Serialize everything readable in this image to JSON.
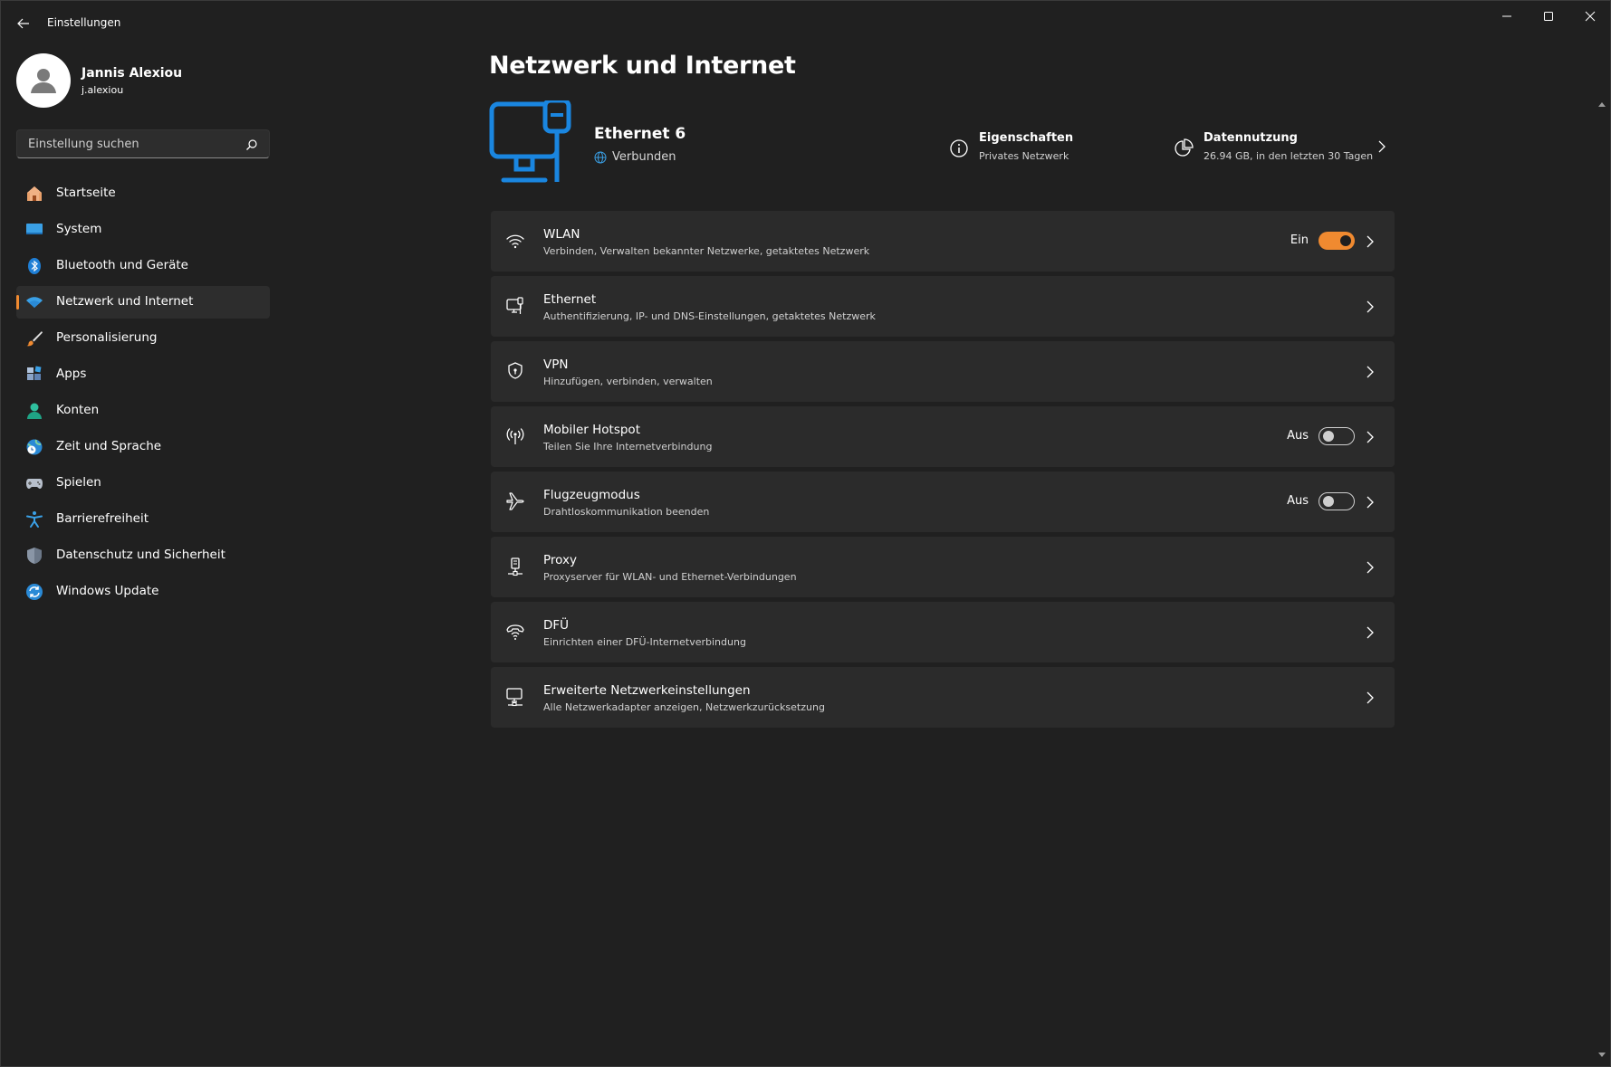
{
  "window": {
    "title": "Einstellungen"
  },
  "profile": {
    "name": "Jannis Alexiou",
    "username": "j.alexiou"
  },
  "search": {
    "placeholder": "Einstellung suchen"
  },
  "sidebar": {
    "items": [
      {
        "label": "Startseite",
        "icon": "home-icon"
      },
      {
        "label": "System",
        "icon": "system-icon"
      },
      {
        "label": "Bluetooth und Geräte",
        "icon": "bluetooth-icon"
      },
      {
        "label": "Netzwerk und Internet",
        "icon": "wifi-icon",
        "active": true
      },
      {
        "label": "Personalisierung",
        "icon": "brush-icon"
      },
      {
        "label": "Apps",
        "icon": "apps-icon"
      },
      {
        "label": "Konten",
        "icon": "account-icon"
      },
      {
        "label": "Zeit und Sprache",
        "icon": "globe-clock-icon"
      },
      {
        "label": "Spielen",
        "icon": "gamepad-icon"
      },
      {
        "label": "Barrierefreiheit",
        "icon": "accessibility-icon"
      },
      {
        "label": "Datenschutz und Sicherheit",
        "icon": "shield-icon"
      },
      {
        "label": "Windows Update",
        "icon": "update-icon"
      }
    ]
  },
  "main": {
    "title": "Netzwerk und Internet",
    "hero": {
      "name": "Ethernet 6",
      "status": "Verbunden",
      "properties": {
        "title": "Eigenschaften",
        "subtitle": "Privates Netzwerk"
      },
      "usage": {
        "title": "Datennutzung",
        "subtitle": "26.94 GB, in den letzten 30 Tagen"
      }
    },
    "cards": [
      {
        "title": "WLAN",
        "subtitle": "Verbinden, Verwalten bekannter Netzwerke, getaktetes Netzwerk",
        "icon": "wifi-icon",
        "toggle": "Ein",
        "toggle_on": true
      },
      {
        "title": "Ethernet",
        "subtitle": "Authentifizierung, IP- und DNS-Einstellungen, getaktetes Netzwerk",
        "icon": "ethernet-icon"
      },
      {
        "title": "VPN",
        "subtitle": "Hinzufügen, verbinden, verwalten",
        "icon": "vpn-shield-icon"
      },
      {
        "title": "Mobiler Hotspot",
        "subtitle": "Teilen Sie Ihre Internetverbindung",
        "icon": "hotspot-icon",
        "toggle": "Aus",
        "toggle_on": false
      },
      {
        "title": "Flugzeugmodus",
        "subtitle": "Drahtloskommunikation beenden",
        "icon": "airplane-icon",
        "toggle": "Aus",
        "toggle_on": false
      },
      {
        "title": "Proxy",
        "subtitle": "Proxyserver für WLAN- und Ethernet-Verbindungen",
        "icon": "proxy-icon"
      },
      {
        "title": "DFÜ",
        "subtitle": "Einrichten einer DFÜ-Internetverbindung",
        "icon": "dialup-icon"
      },
      {
        "title": "Erweiterte Netzwerkeinstellungen",
        "subtitle": "Alle Netzwerkadapter anzeigen, Netzwerkzurücksetzung",
        "icon": "network-adapter-icon"
      }
    ]
  },
  "colors": {
    "accent": "#f08a30",
    "background": "#202020",
    "card": "#2b2b2b",
    "hero_blue": "#0f78d4"
  }
}
